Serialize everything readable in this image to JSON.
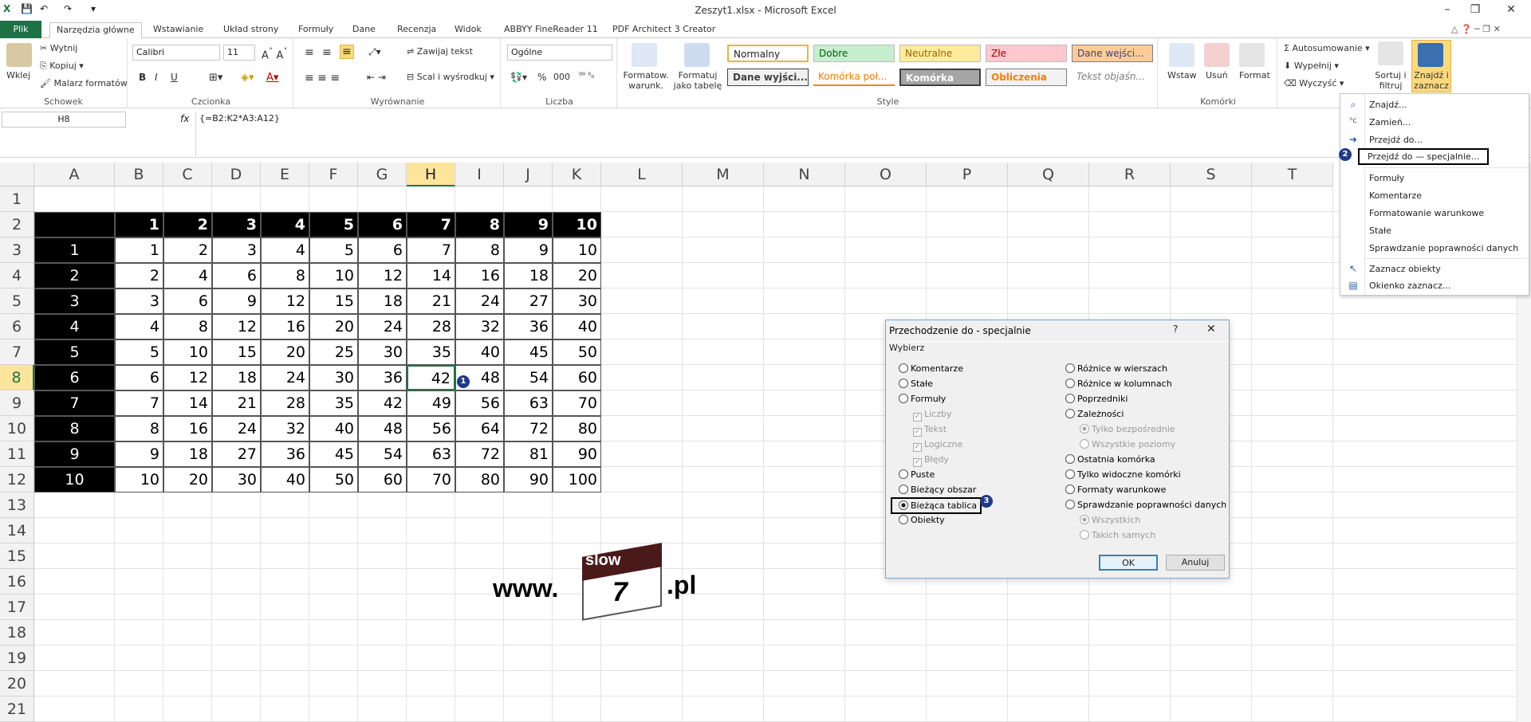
{
  "window": {
    "title": "Zeszyt1.xlsx - Microsoft Excel"
  },
  "tabs": [
    "Plik",
    "Narzędzia główne",
    "Wstawianie",
    "Układ strony",
    "Formuły",
    "Dane",
    "Recenzja",
    "Widok",
    "ABBYY FineReader 11",
    "PDF Architect 3 Creator"
  ],
  "ribbon": {
    "clipboard": {
      "paste": "Wklej",
      "cut": "Wytnij",
      "copy": "Kopiuj",
      "painter": "Malarz formatów",
      "group": "Schowek"
    },
    "font": {
      "name": "Calibri",
      "size": "11",
      "bold": "B",
      "italic": "I",
      "underline": "U",
      "group": "Czcionka"
    },
    "alignment": {
      "wrap": "Zawijaj tekst",
      "merge": "Scal i wyśrodkuj",
      "group": "Wyrównanie"
    },
    "number": {
      "format": "Ogólne",
      "group": "Liczba",
      "percent": "%",
      "thousands": "000"
    },
    "styles_group": {
      "cond": "Formatow. warunk.",
      "table": "Formatuj jako tabelę",
      "group": "Style"
    },
    "styles": [
      "Normalny",
      "Dobre",
      "Neutralne",
      "Złe",
      "Dane wejści...",
      "Dane wyjści...",
      "Komórka poł...",
      "Komórka zaz...",
      "Obliczenia",
      "Tekst objaśn..."
    ],
    "cells": {
      "insert": "Wstaw",
      "delete": "Usuń",
      "format": "Format",
      "group": "Komórki"
    },
    "editing": {
      "autosum": "Autosumowanie",
      "fill": "Wypełnij",
      "clear": "Wyczyść",
      "sort": "Sortuj i filtruj",
      "find": "Znajdź i zaznacz"
    }
  },
  "formula_bar": {
    "name_box": "H8",
    "fx": "fx",
    "formula": "{=B2:K2*A3:A12}"
  },
  "columns": [
    "A",
    "B",
    "C",
    "D",
    "E",
    "F",
    "G",
    "H",
    "I",
    "J",
    "K",
    "L",
    "M",
    "N",
    "O",
    "P",
    "Q",
    "R",
    "S",
    "T"
  ],
  "rows": [
    "1",
    "2",
    "3",
    "4",
    "5",
    "6",
    "7",
    "8",
    "9",
    "10",
    "11",
    "12",
    "13",
    "14",
    "15",
    "16",
    "17",
    "18",
    "19",
    "20",
    "21"
  ],
  "table": {
    "header": [
      "1",
      "2",
      "3",
      "4",
      "5",
      "6",
      "7",
      "8",
      "9",
      "10"
    ],
    "row_labels": [
      "1",
      "2",
      "3",
      "4",
      "5",
      "6",
      "7",
      "8",
      "9",
      "10"
    ],
    "values": [
      [
        "1",
        "2",
        "3",
        "4",
        "5",
        "6",
        "7",
        "8",
        "9",
        "10"
      ],
      [
        "2",
        "4",
        "6",
        "8",
        "10",
        "12",
        "14",
        "16",
        "18",
        "20"
      ],
      [
        "3",
        "6",
        "9",
        "12",
        "15",
        "18",
        "21",
        "24",
        "27",
        "30"
      ],
      [
        "4",
        "8",
        "12",
        "16",
        "20",
        "24",
        "28",
        "32",
        "36",
        "40"
      ],
      [
        "5",
        "10",
        "15",
        "20",
        "25",
        "30",
        "35",
        "40",
        "45",
        "50"
      ],
      [
        "6",
        "12",
        "18",
        "24",
        "30",
        "36",
        "42",
        "48",
        "54",
        "60"
      ],
      [
        "7",
        "14",
        "21",
        "28",
        "35",
        "42",
        "49",
        "56",
        "63",
        "70"
      ],
      [
        "8",
        "16",
        "24",
        "32",
        "40",
        "48",
        "56",
        "64",
        "72",
        "80"
      ],
      [
        "9",
        "18",
        "27",
        "36",
        "45",
        "54",
        "63",
        "72",
        "81",
        "90"
      ],
      [
        "10",
        "20",
        "30",
        "40",
        "50",
        "60",
        "70",
        "80",
        "90",
        "100"
      ]
    ]
  },
  "logo": {
    "www": "www.",
    "slow": "slow",
    "seven": "7",
    "pl": ".pl"
  },
  "dialog": {
    "title": "Przechodzenie do - specjalnie",
    "help": "?",
    "close": "✕",
    "section": "Wybierz",
    "left": [
      "Komentarze",
      "Stałe",
      "Formuły",
      "Liczby",
      "Tekst",
      "Logiczne",
      "Błędy",
      "Puste",
      "Bieżący obszar",
      "Bieżąca tablica",
      "Obiekty"
    ],
    "right": [
      "Różnice w wierszach",
      "Różnice w kolumnach",
      "Poprzedniki",
      "Zależności",
      "Tylko bezpośrednie",
      "Wszystkie poziomy",
      "Ostatnia komórka",
      "Tylko widoczne komórki",
      "Formaty warunkowe",
      "Sprawdzanie poprawności danych",
      "Wszystkich",
      "Takich samych"
    ],
    "ok": "OK",
    "cancel": "Anuluj"
  },
  "menu": {
    "items": [
      "Znajdź...",
      "Zamień...",
      "Przejdź do...",
      "Przejdź do — specjalnie...",
      "Formuły",
      "Komentarze",
      "Formatowanie warunkowe",
      "Stałe",
      "Sprawdzanie poprawności danych",
      "Zaznacz obiekty",
      "Okienko zaznacz..."
    ]
  },
  "badges": [
    "1",
    "2",
    "3"
  ]
}
